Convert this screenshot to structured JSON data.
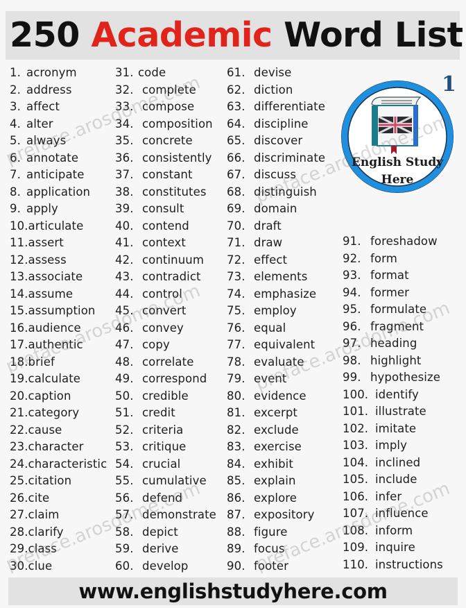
{
  "header": {
    "title_prefix": "250",
    "title_accent": "Academic",
    "title_suffix": "Word List",
    "accent_color": "#e0241c"
  },
  "logo": {
    "badge_number": "1",
    "line1": "English Study",
    "line2": "Here",
    "ring_color": "#1f8fe0",
    "icon": "book-with-union-jack-icon"
  },
  "columns": [
    {
      "items": [
        {
          "num": "1.",
          "word": "acronym"
        },
        {
          "num": "2.",
          "word": "address"
        },
        {
          "num": "3.",
          "word": "affect"
        },
        {
          "num": "4.",
          "word": "alter"
        },
        {
          "num": "5.",
          "word": "always"
        },
        {
          "num": "6.",
          "word": "annotate"
        },
        {
          "num": "7.",
          "word": "anticipate"
        },
        {
          "num": "8.",
          "word": "application"
        },
        {
          "num": "9.",
          "word": "apply"
        },
        {
          "num": "10.",
          "word": "articulate"
        },
        {
          "num": "11.",
          "word": "assert"
        },
        {
          "num": "12.",
          "word": "assess"
        },
        {
          "num": "13.",
          "word": "associate"
        },
        {
          "num": "14.",
          "word": "assume"
        },
        {
          "num": "15.",
          "word": "assumption"
        },
        {
          "num": "16.",
          "word": "audience"
        },
        {
          "num": "17.",
          "word": "authentic"
        },
        {
          "num": "18.",
          "word": "brief"
        },
        {
          "num": "19.",
          "word": "calculate"
        },
        {
          "num": "20.",
          "word": "caption"
        },
        {
          "num": "21.",
          "word": "category"
        },
        {
          "num": "22.",
          "word": "cause"
        },
        {
          "num": "23.",
          "word": "character"
        },
        {
          "num": "24.",
          "word": "characteristic"
        },
        {
          "num": "25.",
          "word": "citation"
        },
        {
          "num": "26.",
          "word": "cite"
        },
        {
          "num": "27.",
          "word": "claim"
        },
        {
          "num": "28.",
          "word": "clarify"
        },
        {
          "num": "29.",
          "word": "class"
        },
        {
          "num": "30.",
          "word": "clue"
        }
      ]
    },
    {
      "items": [
        {
          "num": "31.",
          "word": "code"
        },
        {
          "num": "32.",
          "word": "complete"
        },
        {
          "num": "33.",
          "word": "compose"
        },
        {
          "num": "34.",
          "word": "composition"
        },
        {
          "num": "35.",
          "word": "concrete"
        },
        {
          "num": "36.",
          "word": "consistently"
        },
        {
          "num": "37.",
          "word": "constant"
        },
        {
          "num": "38.",
          "word": "constitutes"
        },
        {
          "num": "39.",
          "word": "consult"
        },
        {
          "num": "40.",
          "word": "contend"
        },
        {
          "num": "41.",
          "word": "context"
        },
        {
          "num": "42.",
          "word": "continuum"
        },
        {
          "num": "43.",
          "word": "contradict"
        },
        {
          "num": "44.",
          "word": "control"
        },
        {
          "num": "45.",
          "word": "convert"
        },
        {
          "num": "46.",
          "word": "convey"
        },
        {
          "num": "47.",
          "word": "copy"
        },
        {
          "num": "48.",
          "word": "correlate"
        },
        {
          "num": "49.",
          "word": "correspond"
        },
        {
          "num": "50.",
          "word": "credible"
        },
        {
          "num": "51.",
          "word": "credit"
        },
        {
          "num": "52.",
          "word": "criteria"
        },
        {
          "num": "53.",
          "word": "critique"
        },
        {
          "num": "54.",
          "word": "crucial"
        },
        {
          "num": "55.",
          "word": "cumulative"
        },
        {
          "num": "56.",
          "word": "defend"
        },
        {
          "num": "57.",
          "word": "demonstrate"
        },
        {
          "num": "58.",
          "word": "depict"
        },
        {
          "num": "59.",
          "word": "derive"
        },
        {
          "num": "60.",
          "word": "develop"
        }
      ]
    },
    {
      "items": [
        {
          "num": "61.",
          "word": "devise"
        },
        {
          "num": "62.",
          "word": "diction"
        },
        {
          "num": "63.",
          "word": "differentiate"
        },
        {
          "num": "64.",
          "word": "discipline"
        },
        {
          "num": "65.",
          "word": "discover"
        },
        {
          "num": "66.",
          "word": "discriminate"
        },
        {
          "num": "67.",
          "word": "discuss"
        },
        {
          "num": "68.",
          "word": "distinguish"
        },
        {
          "num": "69.",
          "word": "domain"
        },
        {
          "num": "70.",
          "word": "draft"
        },
        {
          "num": "71.",
          "word": "draw"
        },
        {
          "num": "72.",
          "word": "effect"
        },
        {
          "num": "73.",
          "word": "elements"
        },
        {
          "num": "74.",
          "word": "emphasize"
        },
        {
          "num": "75.",
          "word": "employ"
        },
        {
          "num": "76.",
          "word": "equal"
        },
        {
          "num": "77.",
          "word": "equivalent"
        },
        {
          "num": "78.",
          "word": "evaluate"
        },
        {
          "num": "79.",
          "word": "event"
        },
        {
          "num": "80.",
          "word": "evidence"
        },
        {
          "num": "81.",
          "word": "excerpt"
        },
        {
          "num": "82.",
          "word": "exclude"
        },
        {
          "num": "83.",
          "word": "exercise"
        },
        {
          "num": "84.",
          "word": "exhibit"
        },
        {
          "num": "85.",
          "word": "explain"
        },
        {
          "num": "86.",
          "word": "explore"
        },
        {
          "num": "87.",
          "word": "expository"
        },
        {
          "num": "88.",
          "word": "figure"
        },
        {
          "num": "89.",
          "word": "focus"
        },
        {
          "num": "90.",
          "word": "footer"
        }
      ]
    },
    {
      "items": [
        {
          "num": "91.",
          "word": "foreshadow"
        },
        {
          "num": "92.",
          "word": "form"
        },
        {
          "num": "93.",
          "word": "format"
        },
        {
          "num": "94.",
          "word": "former"
        },
        {
          "num": "95.",
          "word": "formulate"
        },
        {
          "num": "96.",
          "word": "fragment"
        },
        {
          "num": "97.",
          "word": "heading"
        },
        {
          "num": "98.",
          "word": "highlight"
        },
        {
          "num": "99.",
          "word": "hypothesize"
        },
        {
          "num": "100.",
          "word": "identify"
        },
        {
          "num": "101.",
          "word": "illustrate"
        },
        {
          "num": "102.",
          "word": "imitate"
        },
        {
          "num": "103.",
          "word": "imply"
        },
        {
          "num": "104.",
          "word": "inclined"
        },
        {
          "num": "105.",
          "word": "include"
        },
        {
          "num": "106.",
          "word": "infer"
        },
        {
          "num": "107.",
          "word": "influence"
        },
        {
          "num": "108.",
          "word": "inform"
        },
        {
          "num": "109.",
          "word": "inquire"
        },
        {
          "num": "110.",
          "word": "instructions"
        }
      ]
    }
  ],
  "footer": {
    "url": "www.englishstudyhere.com"
  },
  "watermark": {
    "text": "preface.arosdome.com"
  }
}
